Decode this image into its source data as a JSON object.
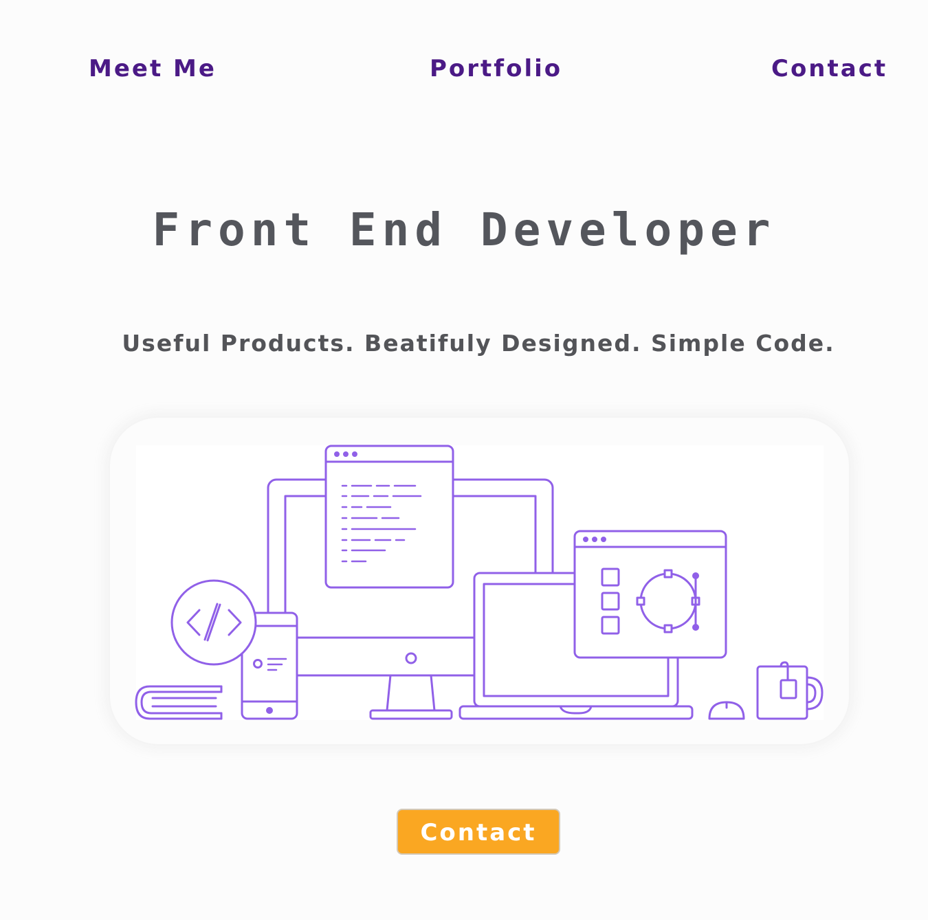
{
  "nav": {
    "items": [
      {
        "label": "Meet Me"
      },
      {
        "label": "Portfolio"
      },
      {
        "label": "Contact"
      }
    ]
  },
  "hero": {
    "title": "Front End Developer",
    "subtitle": "Useful Products. Beatifuly Designed. Simple Code."
  },
  "illustration": {
    "stroke_color": "#9060e8",
    "code_glyph": "</>"
  },
  "cta": {
    "label": "Contact"
  },
  "colors": {
    "nav": "#4b1a86",
    "heading": "#54565c",
    "cta_background": "#faa722",
    "background": "#fcfcfc"
  }
}
